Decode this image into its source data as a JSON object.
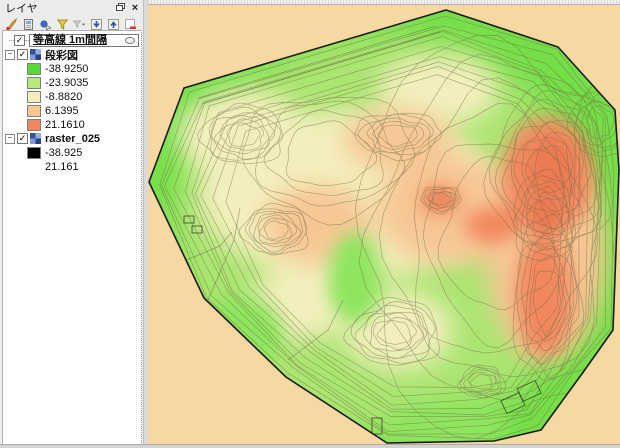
{
  "panel": {
    "title": "レイヤ",
    "glyphs": {
      "check": "✓",
      "expand": "−",
      "close": "×",
      "caret": "▾"
    },
    "toolbar": [
      {
        "name": "layer-styling"
      },
      {
        "name": "manage-themes"
      },
      {
        "name": "filter-map-content"
      },
      {
        "name": "filter-legend"
      },
      {
        "name": "filter-expression"
      },
      {
        "name": "expand-all"
      },
      {
        "name": "collapse-all"
      },
      {
        "name": "remove-layer"
      }
    ],
    "layers": [
      {
        "name": "等高線 1m間隔",
        "checked": true,
        "selected": true,
        "symbol": "ellipse"
      },
      {
        "name": "段彩図",
        "checked": true,
        "expanded": true,
        "icon": "raster-icon",
        "items": [
          {
            "color": "#57d835",
            "label": "-38.9250"
          },
          {
            "color": "#b9e87d",
            "label": "-23.9035"
          },
          {
            "color": "#f3efbd",
            "label": "-8.8820"
          },
          {
            "color": "#f6c795",
            "label": "6.1395"
          },
          {
            "color": "#f2875f",
            "label": "21.1610"
          }
        ]
      },
      {
        "name": "raster_025",
        "checked": true,
        "expanded": true,
        "icon": "raster-icon",
        "items": [
          {
            "color": "#000000",
            "label": "-38.925"
          },
          {
            "color": "#ffffff",
            "label": "21.161"
          }
        ]
      }
    ]
  },
  "map": {
    "canvas_bg": "#f7d7a2",
    "terrain": {
      "outline": "#1b1b1b",
      "base_green": "#74df48",
      "light_green": "#abe572",
      "valley_green": "#8fe55e",
      "cream": "#f3efbd",
      "tan": "#f6c795",
      "salmon": "#f2875f",
      "red": "#ec7a52",
      "contour": "#6f6640",
      "feature": "#3b3b2b"
    }
  }
}
